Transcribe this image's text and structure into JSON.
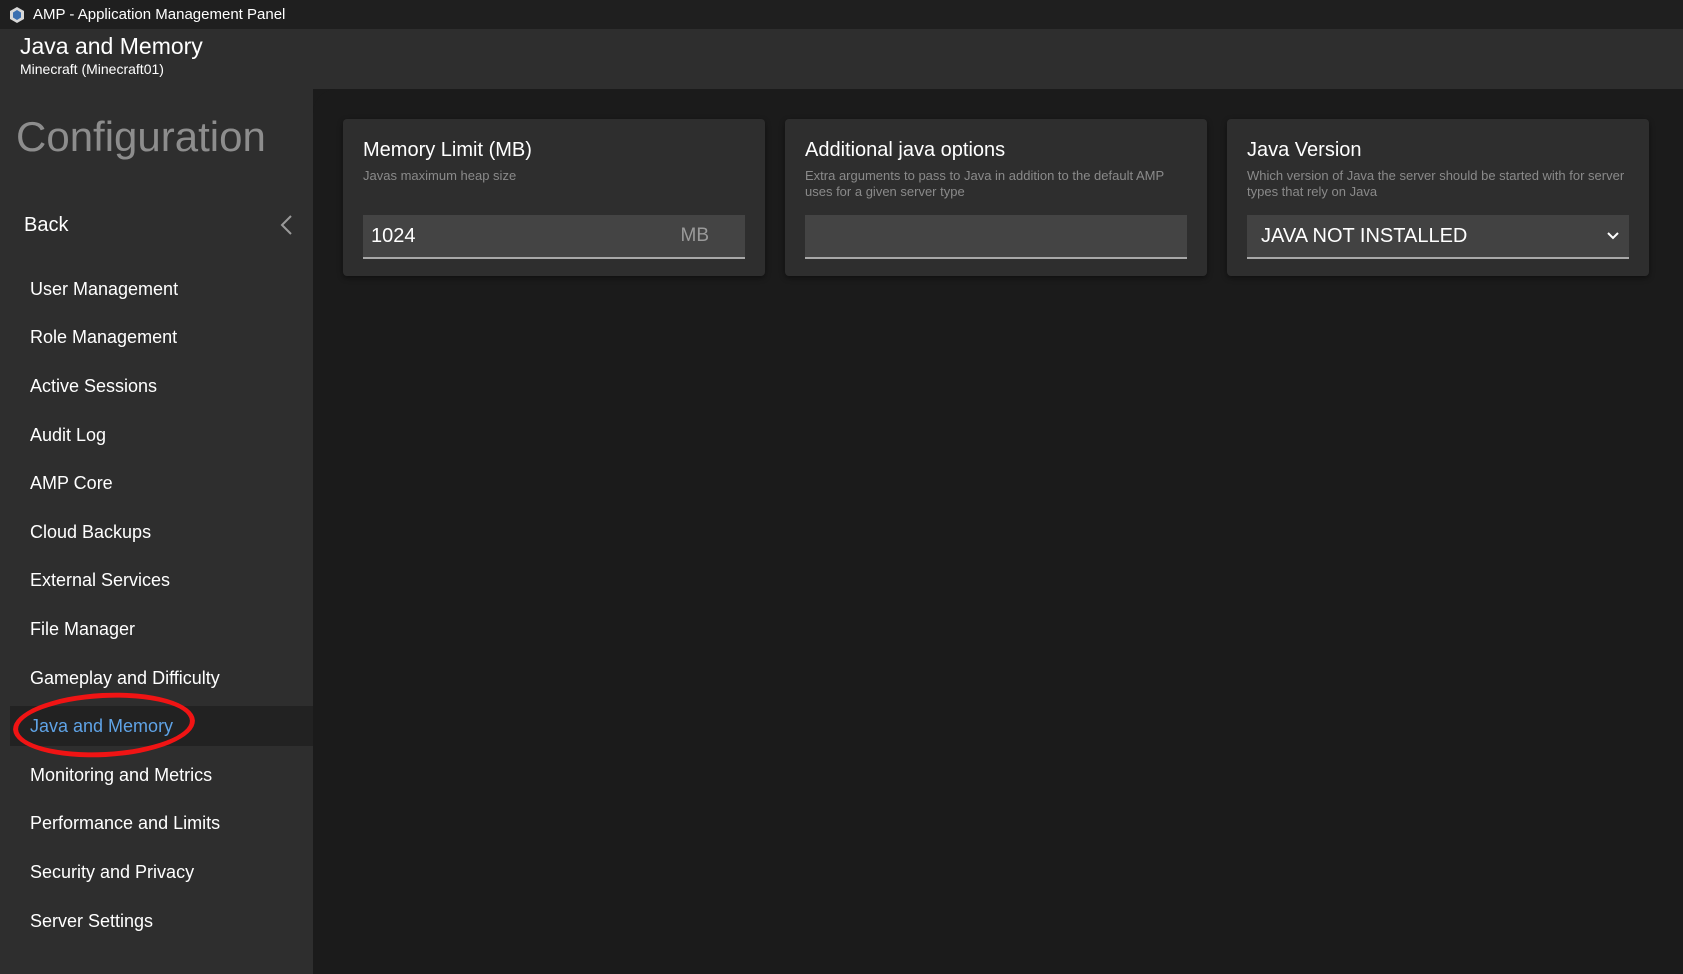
{
  "window": {
    "title": "AMP - Application Management Panel",
    "icon": "amp-logo-icon"
  },
  "header": {
    "title": "Java and Memory",
    "subtitle": "Minecraft (Minecraft01)"
  },
  "sidebar": {
    "section_title": "Configuration",
    "back_label": "Back",
    "items": [
      {
        "label": "User Management"
      },
      {
        "label": "Role Management"
      },
      {
        "label": "Active Sessions"
      },
      {
        "label": "Audit Log"
      },
      {
        "label": "AMP Core"
      },
      {
        "label": "Cloud Backups"
      },
      {
        "label": "External Services"
      },
      {
        "label": "File Manager"
      },
      {
        "label": "Gameplay and Difficulty"
      },
      {
        "label": "Java and Memory"
      },
      {
        "label": "Monitoring and Metrics"
      },
      {
        "label": "Performance and Limits"
      },
      {
        "label": "Security and Privacy"
      },
      {
        "label": "Server Settings"
      }
    ],
    "active_item": "Java and Memory"
  },
  "cards": {
    "memory": {
      "title": "Memory Limit (MB)",
      "description": "Javas maximum heap size",
      "value": "1024",
      "unit": "MB"
    },
    "java_options": {
      "title": "Additional java options",
      "description": "Extra arguments to pass to Java in addition to the default AMP uses for a given server type",
      "value": ""
    },
    "java_version": {
      "title": "Java Version",
      "description": "Which version of Java the server should be started with for server types that rely on Java",
      "selected": "JAVA NOT INSTALLED"
    }
  },
  "colors": {
    "accent": "#5fa3e6",
    "annotation": "#f01414",
    "panel": "#2e2e2e",
    "background": "#1b1b1b"
  }
}
